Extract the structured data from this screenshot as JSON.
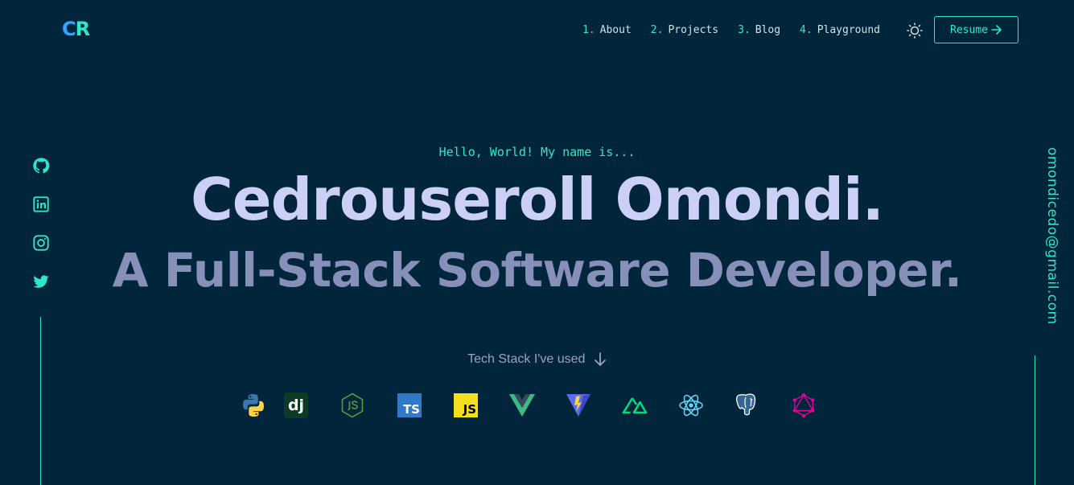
{
  "logo": {
    "text_c": "C",
    "text_r": "R"
  },
  "nav": [
    {
      "num": "1.",
      "label": "About"
    },
    {
      "num": "2.",
      "label": "Projects"
    },
    {
      "num": "3.",
      "label": "Blog"
    },
    {
      "num": "4.",
      "label": "Playground"
    }
  ],
  "theme_toggle_icon": "sun-icon",
  "resume": {
    "label": "Resume",
    "icon": "arrow-right-icon"
  },
  "social": [
    "github-icon",
    "linkedin-icon",
    "instagram-icon",
    "twitter-icon"
  ],
  "email": "omondicedo@gmail.com",
  "hero": {
    "greeting": "Hello, World! My name is...",
    "name": "Cedrouseroll Omondi.",
    "role": "A Full-Stack Software Developer."
  },
  "tech_stack": {
    "label": "Tech Stack I've used",
    "icons": [
      "python-icon",
      "django-icon",
      "nodejs-icon",
      "typescript-icon",
      "javascript-icon",
      "vue-icon",
      "vite-icon",
      "nuxt-icon",
      "react-icon",
      "postgresql-icon",
      "graphql-icon"
    ],
    "django_text": "dj",
    "ts_text": "TS",
    "js_text": "JS"
  },
  "colors": {
    "background": "#01253a",
    "accent": "#2ee6c8",
    "name": "#ccd0f7",
    "role": "#8790b8"
  }
}
